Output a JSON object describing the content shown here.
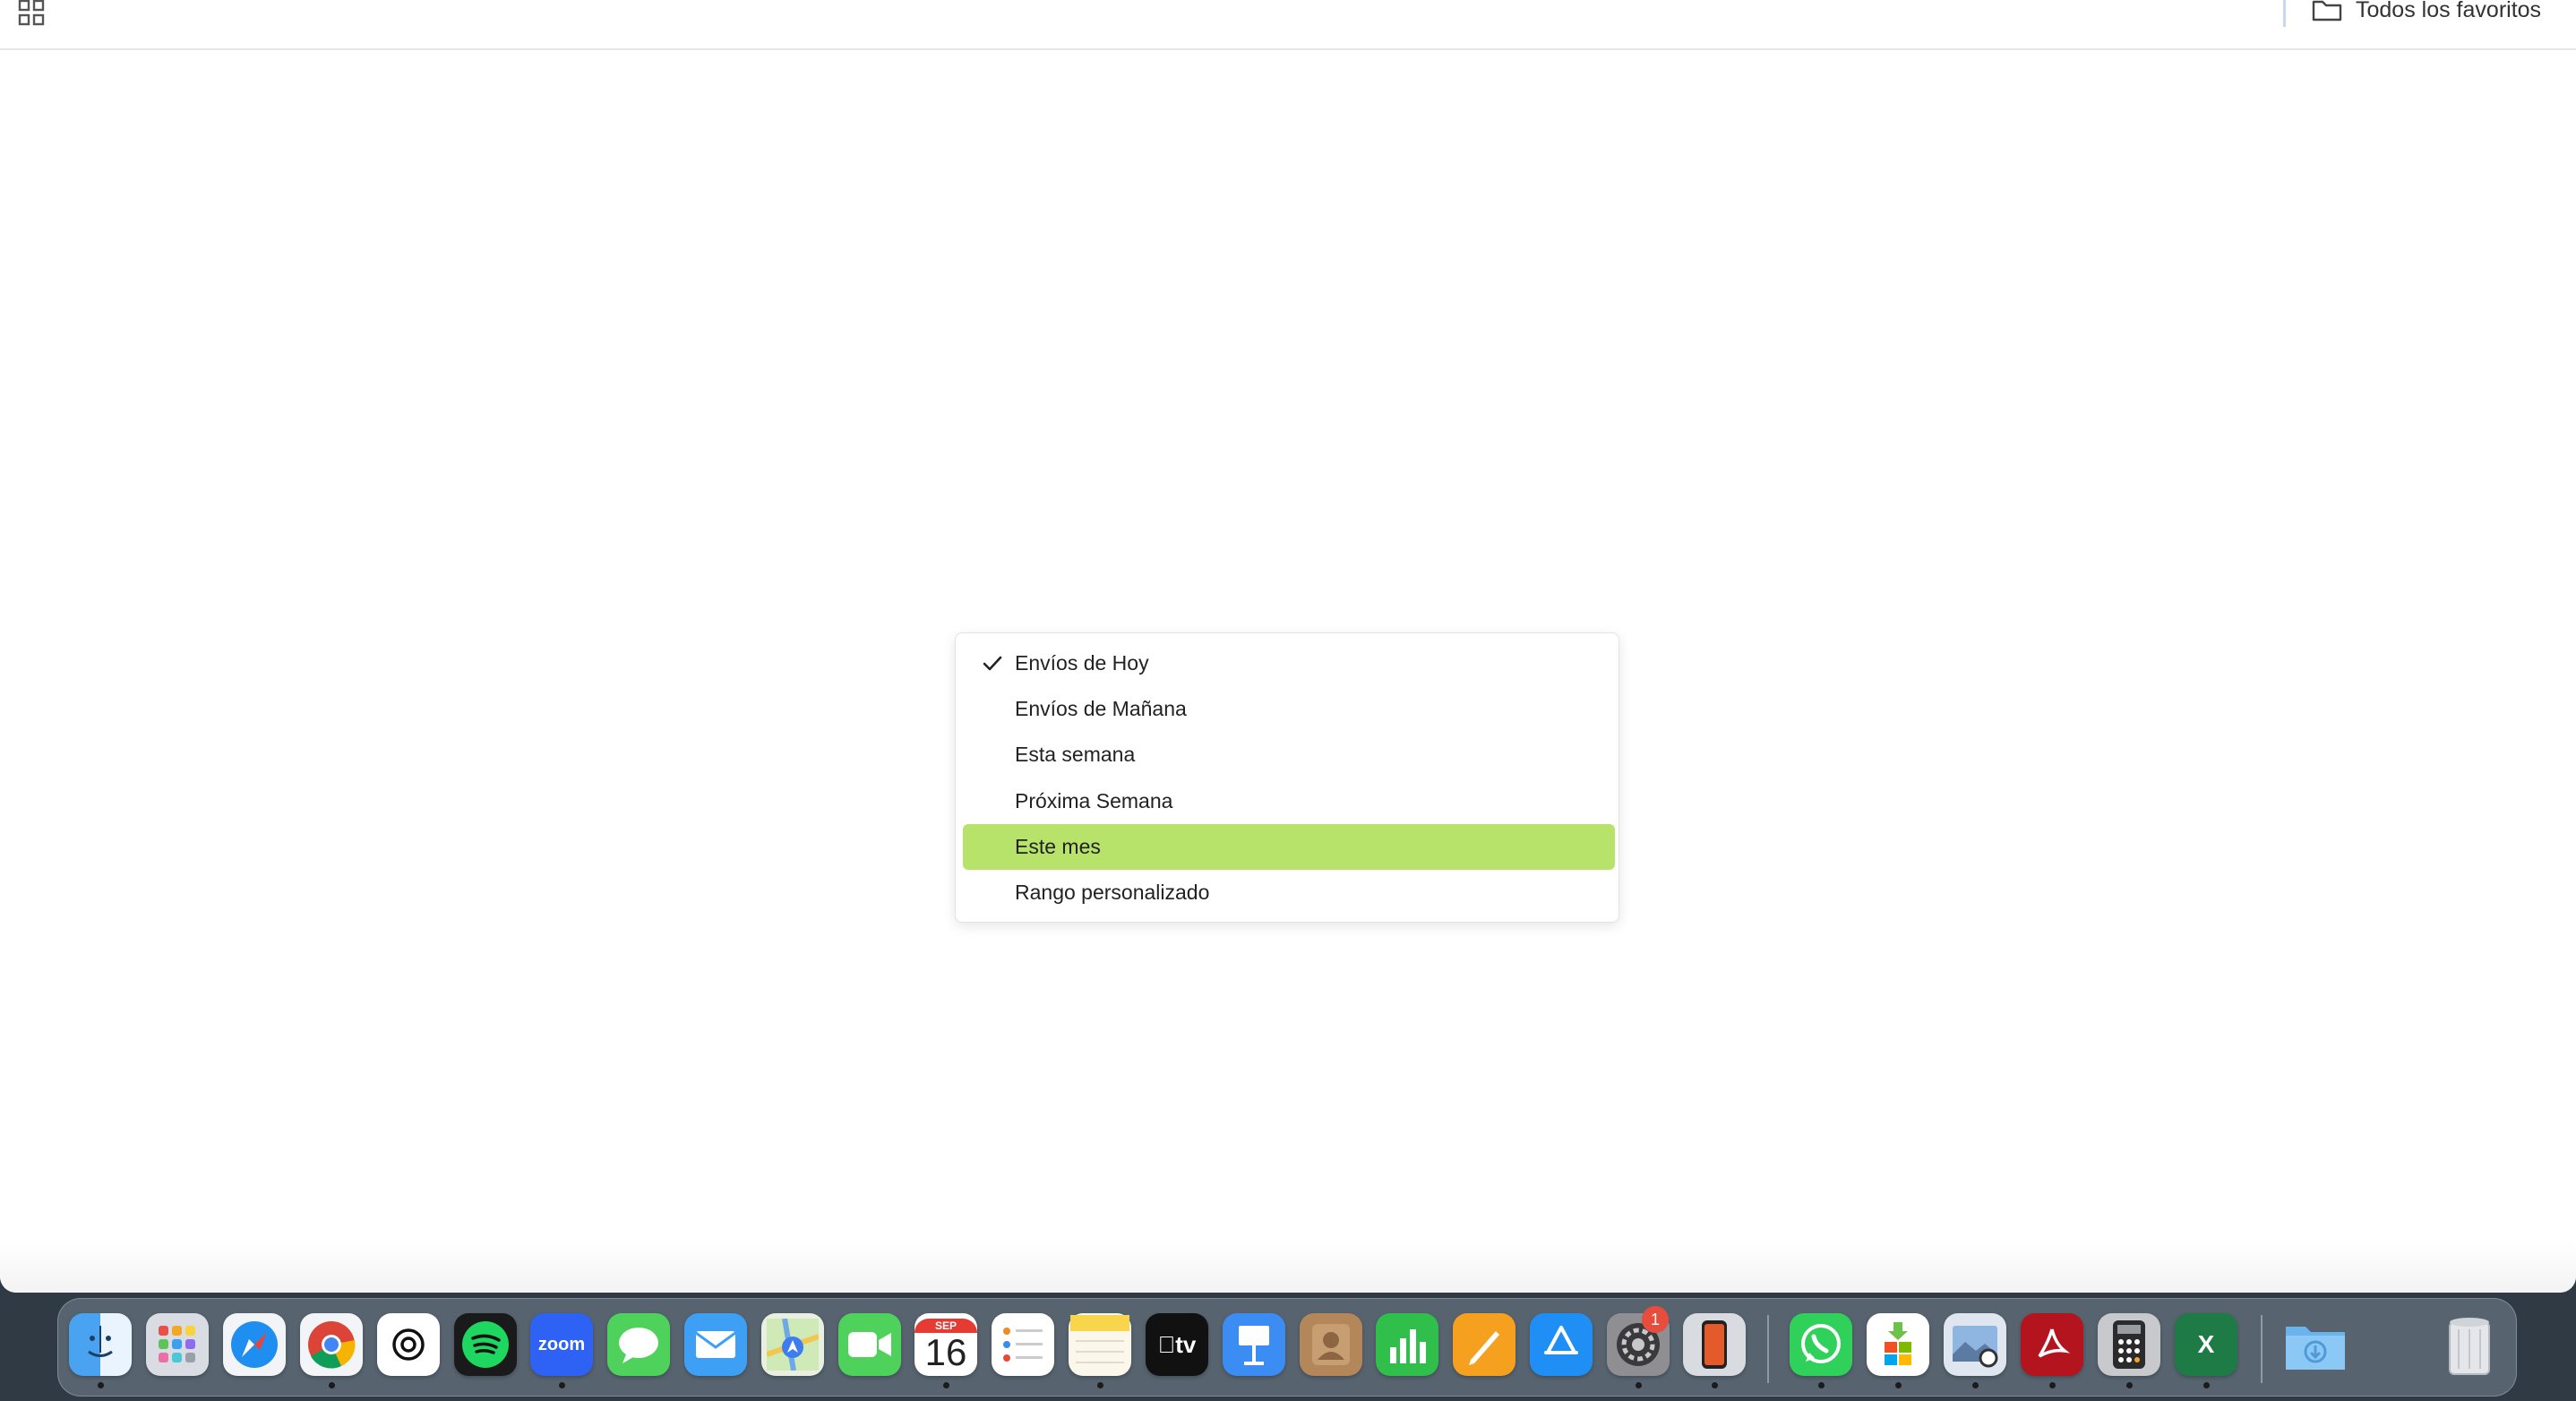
{
  "topbar": {
    "apps_icon": "apps-grid-icon",
    "bookmark_folder_icon": "folder-icon",
    "bookmark_folder_label": "Todos los favoritos"
  },
  "menu": {
    "items": [
      {
        "label": "Envíos de Hoy",
        "checked": true,
        "highlighted": false
      },
      {
        "label": "Envíos de Mañana",
        "checked": false,
        "highlighted": false
      },
      {
        "label": "Esta semana",
        "checked": false,
        "highlighted": false
      },
      {
        "label": "Próxima Semana",
        "checked": false,
        "highlighted": false
      },
      {
        "label": "Este mes",
        "checked": false,
        "highlighted": true
      },
      {
        "label": "Rango personalizado",
        "checked": false,
        "highlighted": false
      }
    ],
    "highlight_color": "#b8e36a"
  },
  "dock": {
    "calendar_month": "SEP",
    "calendar_day": "16",
    "zoom_label": "zoom",
    "settings_badge": "1",
    "appletv_label": "tv",
    "excel_label": "X",
    "apps": [
      "finder",
      "launchpad",
      "safari",
      "chrome",
      "chatgpt",
      "spotify",
      "zoom",
      "messages",
      "mail",
      "maps",
      "facetime",
      "calendar",
      "reminders",
      "notes",
      "apple-tv",
      "keynote",
      "contacts",
      "numbers",
      "pages",
      "app-store",
      "system-settings",
      "iphone-mirroring",
      "whatsapp",
      "microsoft-store",
      "preview",
      "acrobat",
      "calculator",
      "excel",
      "downloads",
      "trash"
    ]
  }
}
